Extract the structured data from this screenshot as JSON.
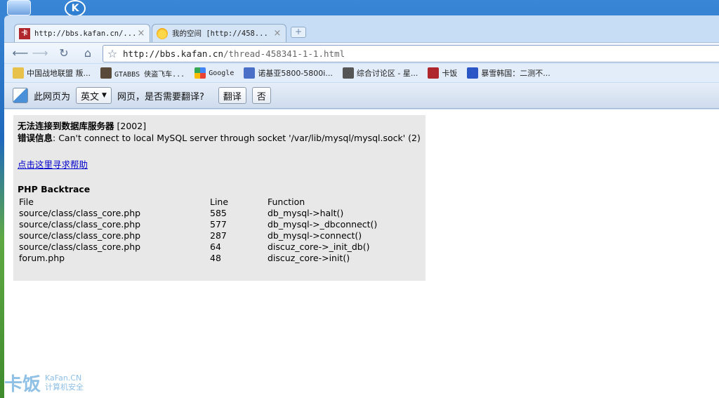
{
  "tabs": [
    {
      "title": "http://bbs.kafan.cn/...",
      "close": "×"
    },
    {
      "title": "我的空间 [http://458...",
      "close": "×"
    }
  ],
  "new_tab": "+",
  "toolbar": {
    "url_domain": "http://bbs.kafan.cn",
    "url_path": "/thread-458341-1-1.html"
  },
  "bookmarks": [
    {
      "label": "中国战地联盟 叛...",
      "icon": "bookmark-icon",
      "color": "#e8c14a"
    },
    {
      "label": "GTABBS 侠盗飞车...",
      "icon": "bookmark-icon",
      "color": "#5a4a3a"
    },
    {
      "label": "Google",
      "icon": "google-icon",
      "color": "#4285f4"
    },
    {
      "label": "诺基亚5800-5800i...",
      "icon": "bookmark-icon",
      "color": "#4a6fc7"
    },
    {
      "label": "综合讨论区 - 星...",
      "icon": "bookmark-icon",
      "color": "#555555"
    },
    {
      "label": "卡饭",
      "icon": "kafan-icon",
      "color": "#b0262d"
    },
    {
      "label": "暴雪韩国：二测不...",
      "icon": "bookmark-icon",
      "color": "#2b56c6"
    }
  ],
  "translate_bar": {
    "prefix": "此网页为",
    "language": "英文",
    "suffix": "网页，是否需要翻译?",
    "translate_button": "翻译",
    "no_button": "否"
  },
  "error": {
    "title_label": "无法连接到数据库服务器",
    "title_code": "[2002]",
    "info_label": "错误信息",
    "info_text": ": Can't connect to local MySQL server through socket '/var/lib/mysql/mysql.sock' (2)",
    "help_link": "点击这里寻求帮助",
    "backtrace_title": "PHP Backtrace",
    "columns": [
      "File",
      "Line",
      "Function"
    ],
    "rows": [
      [
        "source/class/class_core.php",
        "585",
        "db_mysql->halt()"
      ],
      [
        "source/class/class_core.php",
        "577",
        "db_mysql->_dbconnect()"
      ],
      [
        "source/class/class_core.php",
        "287",
        "db_mysql->connect()"
      ],
      [
        "source/class/class_core.php",
        "64",
        "discuz_core->_init_db()"
      ],
      [
        "forum.php",
        "48",
        "discuz_core->init()"
      ]
    ]
  },
  "watermark": {
    "logo": "卡饭",
    "line1": "KaFan.CN",
    "line2": "计算机安全"
  }
}
